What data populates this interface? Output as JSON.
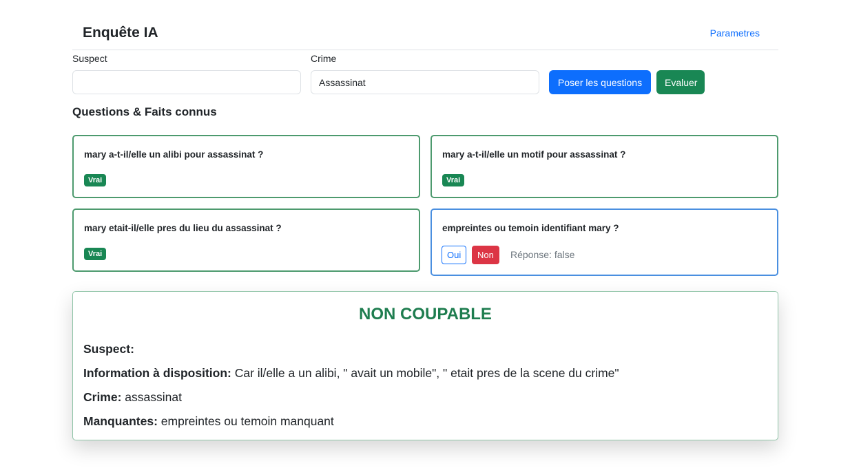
{
  "navbar": {
    "brand": "Enquête IA",
    "settings_link": "Parametres"
  },
  "form": {
    "suspect_label": "Suspect",
    "suspect_value": "",
    "crime_label": "Crime",
    "crime_value": "Assassinat",
    "ask_button": "Poser les questions",
    "evaluate_button": "Evaluer"
  },
  "questions": {
    "title": "Questions & Faits connus",
    "items": [
      {
        "text": "mary a-t-il/elle un alibi pour assassinat ?",
        "badge": "Vrai"
      },
      {
        "text": "mary a-t-il/elle un motif pour assassinat ?",
        "badge": "Vrai"
      },
      {
        "text": "mary etait-il/elle pres du lieu du assassinat ?",
        "badge": "Vrai"
      },
      {
        "text": "empreintes ou temoin identifiant mary ?",
        "yes_label": "Oui",
        "no_label": "Non",
        "answer": "Réponse: false"
      }
    ]
  },
  "result": {
    "verdict": "NON COUPABLE",
    "suspect_label": "Suspect:",
    "suspect_value": "",
    "info_label": "Information à disposition:",
    "info_value": " Car il/elle a un alibi, \" avait un mobile\", \" etait pres de la scene du crime\"",
    "crime_label": "Crime:",
    "crime_value": " assassinat",
    "missing_label": "Manquantes:",
    "missing_value": " empreintes ou temoin manquant"
  },
  "colors": {
    "primary": "#0d6efd",
    "success": "#198754",
    "danger": "#dc3545",
    "verdict": "#1e7d4f"
  }
}
